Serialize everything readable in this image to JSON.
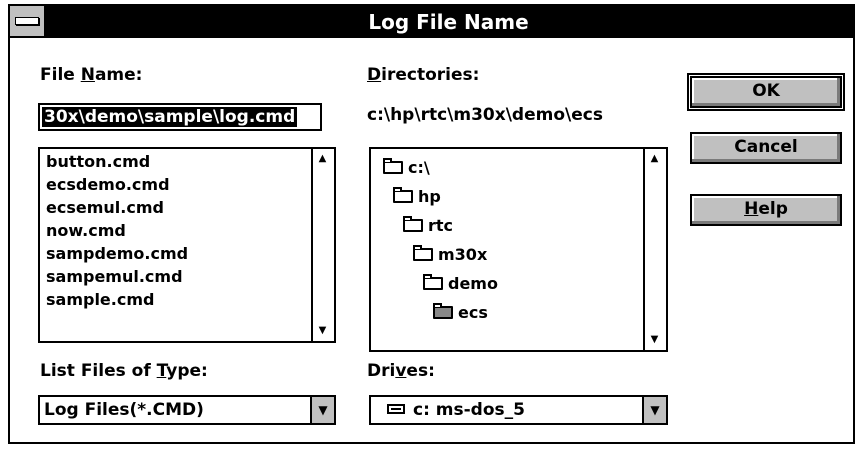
{
  "window": {
    "title": "Log File Name"
  },
  "file_name": {
    "label_pre": "File ",
    "label_key": "N",
    "label_post": "ame:",
    "value": "30x\\demo\\sample\\log.cmd"
  },
  "files": [
    "button.cmd",
    "ecsdemo.cmd",
    "ecsemul.cmd",
    "now.cmd",
    "sampdemo.cmd",
    "sampemul.cmd",
    "sample.cmd"
  ],
  "directories": {
    "label_key": "D",
    "label_post": "irectories:",
    "current_path": "c:\\hp\\rtc\\m30x\\demo\\ecs",
    "items": [
      "c:\\",
      "hp",
      "rtc",
      "m30x",
      "demo",
      "ecs"
    ]
  },
  "file_type": {
    "label_pre": "List Files of ",
    "label_key": "T",
    "label_post": "ype:",
    "value": "Log Files(*.CMD)"
  },
  "drives": {
    "label_pre": "Dri",
    "label_key": "v",
    "label_post": "es:",
    "value": "c: ms-dos_5"
  },
  "buttons": {
    "ok": "OK",
    "cancel": "Cancel",
    "help_key": "H",
    "help_rest": "elp"
  },
  "icons": {
    "scroll_up": "▲",
    "scroll_down": "▼",
    "dropdown": "▼"
  }
}
